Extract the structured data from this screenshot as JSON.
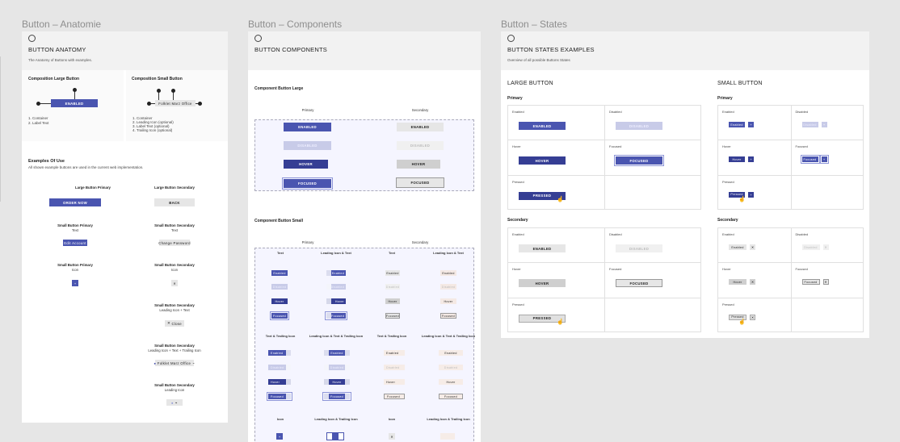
{
  "labels": {
    "anatomie": "Button – Anatomie",
    "components": "Button – Components",
    "states": "Button – States"
  },
  "anatomie": {
    "title": "BUTTON ANATOMY",
    "subtitle": "The Anatomy of Buttons with examples.",
    "large_title": "Composition Large Button",
    "large_btn": "ENABLED",
    "large_list": [
      "1. Container",
      "2. Label Text"
    ],
    "small_title": "Composition Small Button",
    "small_btn": "Folklet Marz Office",
    "small_list": [
      "1. Container",
      "2. Leading Icon (optional)",
      "3. Label Text (optional)",
      "4. Trailing Icon (optional)"
    ],
    "examples_title": "Examples Of Use",
    "examples_sub": "All shown example buttons are used in the current web implementation.",
    "ex1_title": "Large Button Primary",
    "ex1_btn": "ORDER NOW",
    "ex2_title": "Large Button Secondary",
    "ex2_btn": "BACK",
    "ex3_title": "Small Button Primary",
    "ex3_sub": "Text",
    "ex3_btn": "Edit Account",
    "ex4_title": "Small Button Secondary",
    "ex4_sub": "Text",
    "ex4_btn": "Change Password",
    "ex5_title": "Small Button Primary",
    "ex5_sub": "Icon",
    "ex6_title": "Small Button Secondary",
    "ex6_sub": "Icon",
    "ex7_title": "Small Button Secondary",
    "ex7_sub": "Leading Icon + Text",
    "ex7_btn": "Close",
    "ex8_title": "Small Button Secondary",
    "ex8_sub": "Leading Icon + Text + Trailing Icon",
    "ex8_btn": "Folklet Marz Office",
    "ex9_title": "Small Button Secondary",
    "ex9_sub": "Leading Icon"
  },
  "components": {
    "title": "BUTTON COMPONENTS",
    "large_title": "Component Button Large",
    "primary": "Primary",
    "secondary": "Secondary",
    "large_states": [
      "ENABLED",
      "DISABLED",
      "HOVER",
      "FOCUSED"
    ],
    "small_title": "Component Button Small",
    "cols_row1": [
      "Text",
      "Leading Icon & Text",
      "Text",
      "Leading Icon & Text"
    ],
    "cols_row2": [
      "Text & Trailing Icon",
      "Leading Icon & Text & Trailing Icon",
      "Text & Trailing Icon",
      "Leading Icon & Text & Trailing Icon"
    ],
    "cols_row3": [
      "Icon",
      "Leading Icon & Trailing Icon",
      "Icon",
      "Leading Icon & Trailing Icon"
    ],
    "small_states": [
      "Enabled",
      "Disabled",
      "Hover",
      "Focused"
    ]
  },
  "states": {
    "title": "BUTTON STATES EXAMPLES",
    "subtitle": "Overview of all possible Buttons States",
    "large": "LARGE BUTTON",
    "small": "SMALL BUTTON",
    "primary": "Primary",
    "secondary": "Secondary",
    "state_labels": [
      "Enabled",
      "Disabled",
      "Hover",
      "Focused",
      "Pressed"
    ],
    "large_btns": [
      "ENABLED",
      "DISABLED",
      "HOVER",
      "FOCUSED",
      "PRESSED"
    ],
    "small_btns": [
      "Enabled",
      "Disabled",
      "Hover",
      "Focused",
      "Pressed"
    ]
  },
  "colors": {
    "primary": "#4a55b0",
    "primary_hover": "#353e94",
    "primary_disabled": "#c8cbe8",
    "secondary": "#e6e6e6",
    "canvas": "#e6e6e6"
  }
}
